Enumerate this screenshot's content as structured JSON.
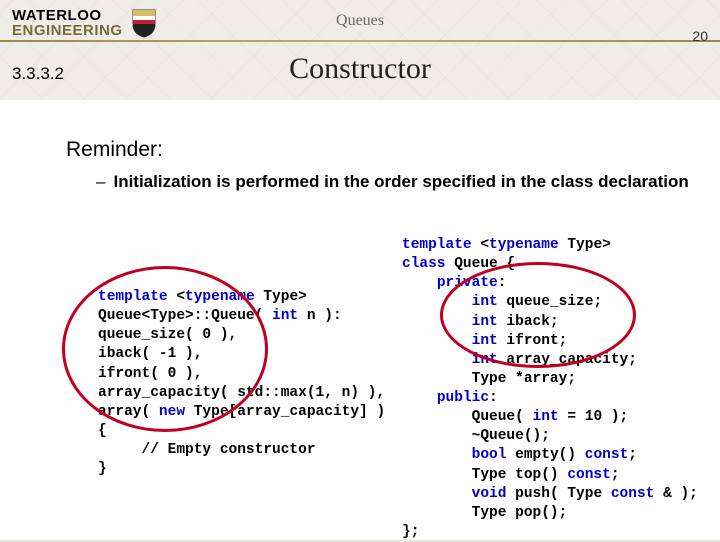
{
  "header": {
    "brand_top": "WATERLOO",
    "brand_bottom": "ENGINEERING",
    "doc_title": "Queues",
    "page_number": "20",
    "section_number": "3.3.3.2",
    "slide_title": "Constructor"
  },
  "body": {
    "reminder_label": "Reminder:",
    "bullet_dash": "–",
    "bullet_text": "Initialization is performed in the order specified in the class declaration"
  },
  "code_left": {
    "l1a": "template",
    "l1b": " <",
    "l1c": "typename",
    "l1d": " Type>",
    "l2": "Queue<Type>::Queue( ",
    "l2b": "int",
    "l2c": " n ):",
    "l3": "queue_size( 0 ),",
    "l4": "iback( -1 ),",
    "l5": "ifront( 0 ),",
    "l6": "array_capacity( std::max(1, n) ),",
    "l7a": "array( ",
    "l7b": "new",
    "l7c": " Type[array_capacity] )",
    "l8": "{",
    "l9": "     // Empty constructor",
    "l10": "}"
  },
  "code_right": {
    "l1a": "template",
    "l1b": " <",
    "l1c": "typename",
    "l1d": " Type>",
    "l2a": "class",
    "l2b": " Queue {",
    "l3": "    ",
    "l3b": "private",
    "l3c": ":",
    "l4": "        ",
    "l4b": "int",
    "l4c": " queue_size;",
    "l5": "        ",
    "l5b": "int",
    "l5c": " iback;",
    "l6": "        ",
    "l6b": "int",
    "l6c": " ifront;",
    "l7": "        ",
    "l7b": "int",
    "l7c": " array_capacity;",
    "l8": "        Type *array;",
    "l9": "    ",
    "l9b": "public",
    "l9c": ":",
    "l10": "        Queue( ",
    "l10b": "int",
    "l10c": " = 10 );",
    "l11": "        ~Queue();",
    "l12": "        ",
    "l12b": "bool",
    "l12c": " empty() ",
    "l12d": "const",
    "l12e": ";",
    "l13": "        Type top() ",
    "l13b": "const",
    "l13c": ";",
    "l14": "        ",
    "l14b": "void",
    "l14c": " push( Type ",
    "l14d": "const",
    "l14e": " & );",
    "l15": "        Type pop();",
    "l16": "};"
  }
}
